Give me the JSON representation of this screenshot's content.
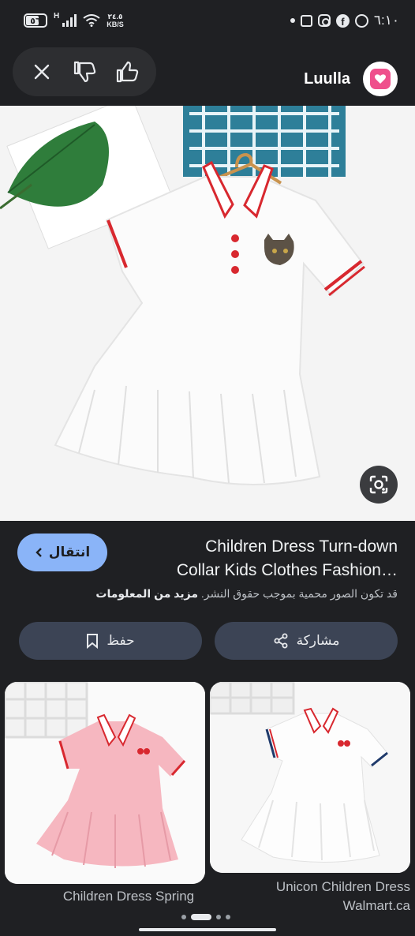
{
  "status_bar": {
    "battery": "٥٦",
    "network": "H",
    "speed_value": "٢٤.٥",
    "speed_unit": "KB/S",
    "time": "٦:١٠"
  },
  "header": {
    "brand_name": "Luulla"
  },
  "result": {
    "title_line1": "Children Dress Turn-down",
    "title_line2": "Collar Kids Clothes Fashion…",
    "visit_label": "انتقال",
    "copyright_text": "قد تكون الصور محمية بموجب حقوق النشر.",
    "learn_more": "مزيد من المعلومات",
    "share_label": "مشاركة",
    "save_label": "حفظ"
  },
  "related": [
    {
      "caption": "Children Dress Spring"
    },
    {
      "caption_line1": "Unicon Children Dress",
      "caption_line2": "Walmart.ca"
    }
  ]
}
